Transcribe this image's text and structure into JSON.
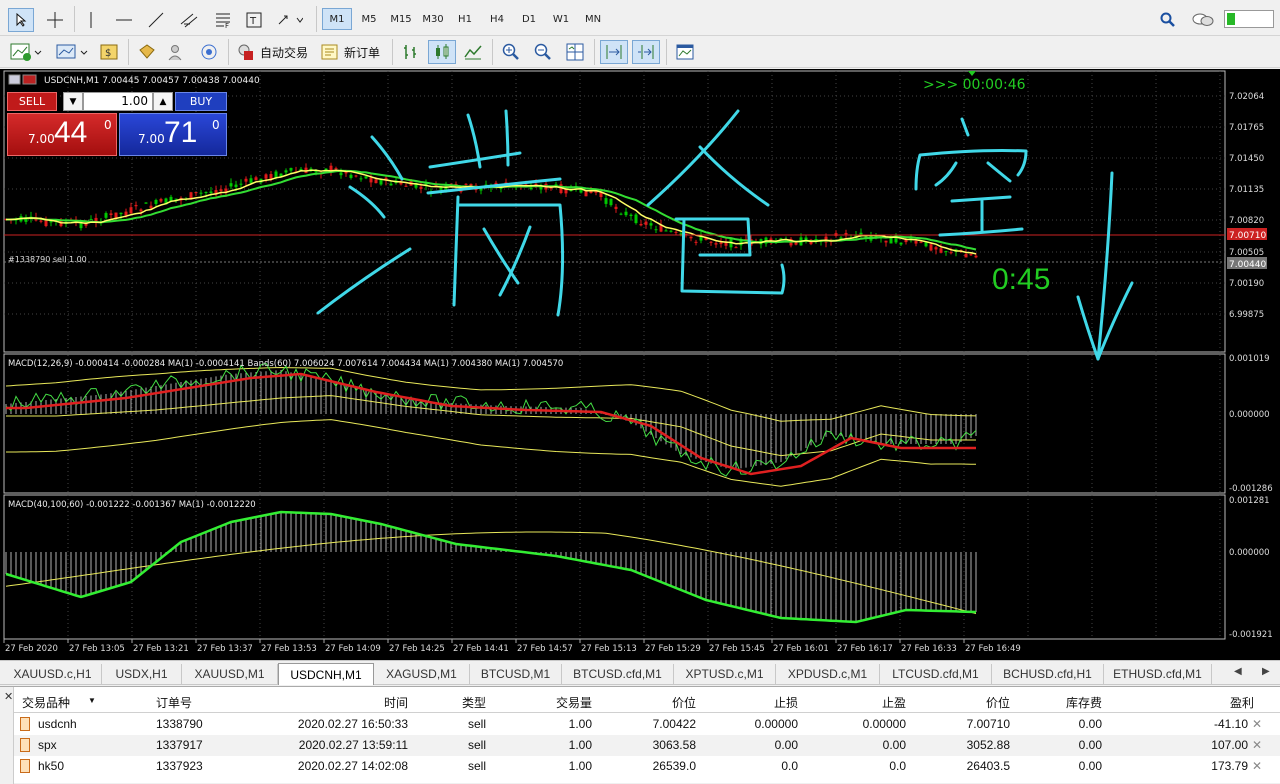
{
  "timeframes": [
    "M1",
    "M5",
    "M15",
    "M30",
    "H1",
    "H4",
    "D1",
    "W1",
    "MN"
  ],
  "active_timeframe": "M1",
  "toolbar2": {
    "auto_trade_label": "自动交易",
    "new_order_label": "新订单"
  },
  "chart": {
    "header": "USDCNH,M1  7.00445 7.00457 7.00438 7.00440",
    "countdown": ">>> 00:00:46",
    "timer_big": "0:45",
    "order_line_label": "#1338790 sell 1.00",
    "price_axis": [
      "7.02064",
      "7.01765",
      "7.01450",
      "7.01135",
      "7.00820",
      "7.00505",
      "7.00190",
      "6.99875"
    ],
    "price_tag_red": "7.00710",
    "price_tag_gray": "7.00440",
    "handwritten_text": [
      "满",
      "仓",
      "空"
    ],
    "macd1_label": "MACD(12,26,9) -0.000414 -0.000284 MA(1) -0.0004141 Bands(60) 7.006024 7.007614 7.004434 MA(1) 7.004380 MA(1) 7.004570",
    "macd1_axis": [
      "0.001019",
      "0.000000",
      "-0.001286"
    ],
    "macd2_label": "MACD(40,100,60) -0.001222 -0.001367 MA(1) -0.0012220",
    "macd2_axis": [
      "0.001281",
      "0.000000",
      "-0.001921"
    ],
    "time_axis": [
      "27 Feb 2020",
      "27 Feb 13:05",
      "27 Feb 13:21",
      "27 Feb 13:37",
      "27 Feb 13:53",
      "27 Feb 14:09",
      "27 Feb 14:25",
      "27 Feb 14:41",
      "27 Feb 14:57",
      "27 Feb 15:13",
      "27 Feb 15:29",
      "27 Feb 15:45",
      "27 Feb 16:01",
      "27 Feb 16:17",
      "27 Feb 16:33",
      "27 Feb 16:49"
    ],
    "colors": {
      "background": "#000000",
      "bull": "#00c800",
      "bear": "#e01a1a",
      "ma_yellow": "#ffff66",
      "ma_green": "#33dd33",
      "handwriting": "#40d8e8",
      "timer": "#22cc22"
    }
  },
  "trade_panel": {
    "sell_label": "SELL",
    "buy_label": "BUY",
    "lot": "1.00",
    "sell_small": "7.00",
    "sell_big": "44",
    "sell_sup": "0",
    "buy_small": "7.00",
    "buy_big": "71",
    "buy_sup": "0"
  },
  "tabs": [
    "XAUUSD.c,H1",
    "USDX,H1",
    "XAUUSD,M1",
    "USDCNH,M1",
    "XAGUSD,M1",
    "BTCUSD,M1",
    "BTCUSD.cfd,M1",
    "XPTUSD.c,M1",
    "XPDUSD.c,M1",
    "LTCUSD.cfd,M1",
    "BCHUSD.cfd,H1",
    "ETHUSD.cfd,M1"
  ],
  "active_tab": "USDCNH,M1",
  "terminal": {
    "columns": [
      "交易品种",
      "订单号",
      "时间",
      "类型",
      "交易量",
      "价位",
      "止损",
      "止盈",
      "价位",
      "库存费",
      "盈利"
    ],
    "rows": [
      {
        "symbol": "usdcnh",
        "order": "1338790",
        "time": "2020.02.27 16:50:33",
        "type": "sell",
        "volume": "1.00",
        "price": "7.00422",
        "sl": "0.00000",
        "tp": "0.00000",
        "cur": "7.00710",
        "swap": "0.00",
        "profit": "-41.10"
      },
      {
        "symbol": "spx",
        "order": "1337917",
        "time": "2020.02.27 13:59:11",
        "type": "sell",
        "volume": "1.00",
        "price": "3063.58",
        "sl": "0.00",
        "tp": "0.00",
        "cur": "3052.88",
        "swap": "0.00",
        "profit": "107.00"
      },
      {
        "symbol": "hk50",
        "order": "1337923",
        "time": "2020.02.27 14:02:08",
        "type": "sell",
        "volume": "1.00",
        "price": "26539.0",
        "sl": "0.0",
        "tp": "0.0",
        "cur": "26403.5",
        "swap": "0.00",
        "profit": "173.79"
      }
    ]
  }
}
